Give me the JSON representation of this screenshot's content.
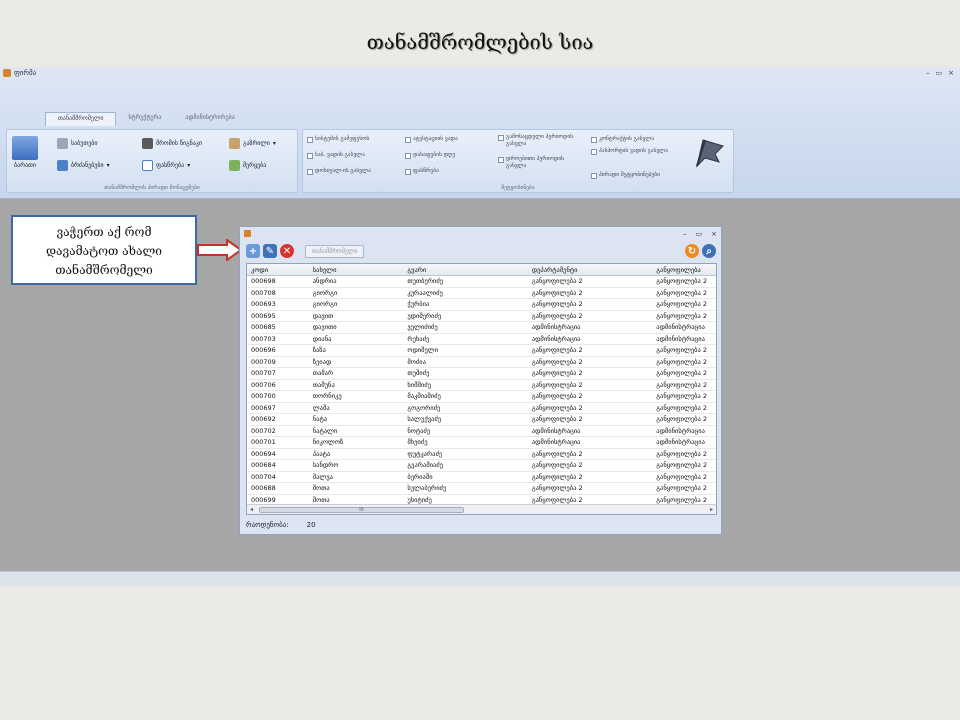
{
  "slide": {
    "title": "თანამშრომლების სია"
  },
  "app": {
    "title": "ფირმა",
    "window_buttons": [
      "–",
      "▭",
      "×"
    ],
    "tabs": [
      "თანამშრომელი",
      "სტრუქტურა",
      "ადმინისტრირება"
    ],
    "groups": {
      "main_label": "თანამშრომლის პირადი მონაცემები",
      "filters_label": "შეტყობინება"
    },
    "buttons": {
      "reports": "ბარათი",
      "office": "საბუთები",
      "work_book": "შრომის წიგნაკი",
      "vacation": "გაზრილი",
      "orders": "ბრძანებები",
      "salary": "ფასწრება",
      "schedule": "მერყება"
    },
    "filters": [
      "სისტემის გამეფესოს",
      "საბ. ვადის გასვლა",
      "დოსიეალ-ის გასვლა",
      "ატესტაციის ვადა",
      "დასაფების დღე",
      "ფასწრება",
      "გამოსაცდელი პერიოდის გასვლა",
      "დროებითი პერიოდის გასვლა",
      "კონტრაქტის გასვლა",
      "პასპორტის ვადის გასვლა",
      "პირადი შეტყობინებები"
    ]
  },
  "callout": {
    "line1": "ვაჭერთ აქ რომ",
    "line2": "დავამატოთ ახალი",
    "line3": "თანამშრომელი"
  },
  "list_window": {
    "tab": "თანამშრომელი",
    "columns": [
      "კოდი",
      "სახელი",
      "გვარი",
      "დეპარტამენტი",
      "განყოფილება"
    ],
    "rows": [
      [
        "000698",
        "ანდრია",
        "თუთბერიძე",
        "განყოფილება 2",
        "განყოფილება 2"
      ],
      [
        "000708",
        "გიორგი",
        "კურაალიძე",
        "განყოფილება 2",
        "განყოფილება 2"
      ],
      [
        "000693",
        "გიორგი",
        "ჭურბია",
        "განყოფილება 2",
        "განყოფილება 2"
      ],
      [
        "000695",
        "დავით",
        "ედიშერიძე",
        "განყოფილება 2",
        "განყოფილება 2"
      ],
      [
        "000685",
        "დავითი",
        "ველიძიძე",
        "ადმინისტრაცია",
        "ადმინისტრაცია"
      ],
      [
        "000703",
        "დიანა",
        "რუხაძე",
        "ადმინისტრაცია",
        "ადმინისტრაცია"
      ],
      [
        "000696",
        "ზაზა",
        "ოდიშელი",
        "განყოფილება 2",
        "განყოფილება 2"
      ],
      [
        "000709",
        "ზეიად",
        "მოძია",
        "განყოფილება 2",
        "განყოფილება 2"
      ],
      [
        "000707",
        "თამარ",
        "თუშიძე",
        "განყოფილება 2",
        "განყოფილება 2"
      ],
      [
        "000706",
        "თამუნა",
        "ხიმშიძე",
        "განყოფილება 2",
        "განყოფილება 2"
      ],
      [
        "000700",
        "თორნიკე",
        "მაკშიაშიძე",
        "განყოფილება 2",
        "განყოფილება 2"
      ],
      [
        "000697",
        "ლაშა",
        "გოგორიძე",
        "განყოფილება 2",
        "განყოფილება 2"
      ],
      [
        "000692",
        "ნატა",
        "სალუქვაძე",
        "განყოფილება 2",
        "განყოფილება 2"
      ],
      [
        "000702",
        "ნატალი",
        "ნოტაძე",
        "ადმინისტრაცია",
        "ადმინისტრაცია"
      ],
      [
        "000701",
        "ნიკოლოზ",
        "მხეიძე",
        "ადმინისტრაცია",
        "ადმინისტრაცია"
      ],
      [
        "000694",
        "პაატა",
        "ფუტკარაძე",
        "განყოფილება 2",
        "განყოფილება 2"
      ],
      [
        "000684",
        "სანდრო",
        "გვარამიაძე",
        "განყოფილება 2",
        "განყოფილება 2"
      ],
      [
        "000704",
        "შალვა",
        "ბერიაში",
        "განყოფილება 2",
        "განყოფილება 2"
      ],
      [
        "000688",
        "შოთა",
        "სულაბერიძე",
        "განყოფილება 2",
        "განყოფილება 2"
      ],
      [
        "000699",
        "შოთა",
        "უსიტიძე",
        "განყოფილება 2",
        "განყოფილება 2"
      ]
    ],
    "scroll_thumb": "III",
    "count_label": "რაოდენობა:",
    "count_value": "20"
  },
  "colors": {
    "accent_red": "#d9342b",
    "callout_border": "#3c68a6",
    "arrow": "#c9302c"
  }
}
